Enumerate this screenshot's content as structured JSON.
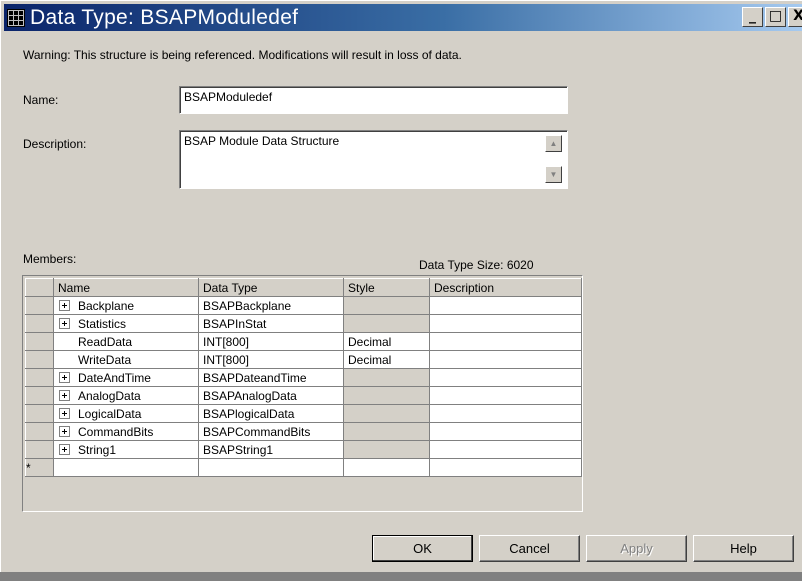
{
  "window": {
    "title": "Data Type:  BSAPModuledef",
    "controls": {
      "minimize": "_",
      "maximize": "□",
      "close": "X"
    }
  },
  "warning": "Warning: This structure is being referenced.  Modifications will result in loss of data.",
  "name": {
    "label": "Name:",
    "value": "BSAPModuledef"
  },
  "description": {
    "label": "Description:",
    "value": "BSAP Module Data Structure"
  },
  "members": {
    "label": "Members:",
    "size_text": "Data Type Size: 6020",
    "columns": [
      "Name",
      "Data Type",
      "Style",
      "Description"
    ],
    "rows": [
      {
        "expandable": true,
        "name": "Backplane",
        "type": "BSAPBackplane",
        "style": "",
        "description": ""
      },
      {
        "expandable": true,
        "name": "Statistics",
        "type": "BSAPInStat",
        "style": "",
        "description": ""
      },
      {
        "expandable": false,
        "name": "ReadData",
        "type": "INT[800]",
        "style": "Decimal",
        "description": ""
      },
      {
        "expandable": false,
        "name": "WriteData",
        "type": "INT[800]",
        "style": "Decimal",
        "description": ""
      },
      {
        "expandable": true,
        "name": "DateAndTime",
        "type": "BSAPDateandTime",
        "style": "",
        "description": ""
      },
      {
        "expandable": true,
        "name": "AnalogData",
        "type": "BSAPAnalogData",
        "style": "",
        "description": ""
      },
      {
        "expandable": true,
        "name": "LogicalData",
        "type": "BSAPlogicalData",
        "style": "",
        "description": ""
      },
      {
        "expandable": true,
        "name": "CommandBits",
        "type": "BSAPCommandBits",
        "style": "",
        "description": ""
      },
      {
        "expandable": true,
        "name": "String1",
        "type": "BSAPString1",
        "style": "",
        "description": ""
      }
    ],
    "new_row_marker": "*"
  },
  "buttons": {
    "ok": "OK",
    "cancel": "Cancel",
    "apply": "Apply",
    "help": "Help"
  },
  "colors": {
    "title_start": "#0a246a",
    "title_end": "#a6caf0",
    "face": "#d4d0c8"
  }
}
